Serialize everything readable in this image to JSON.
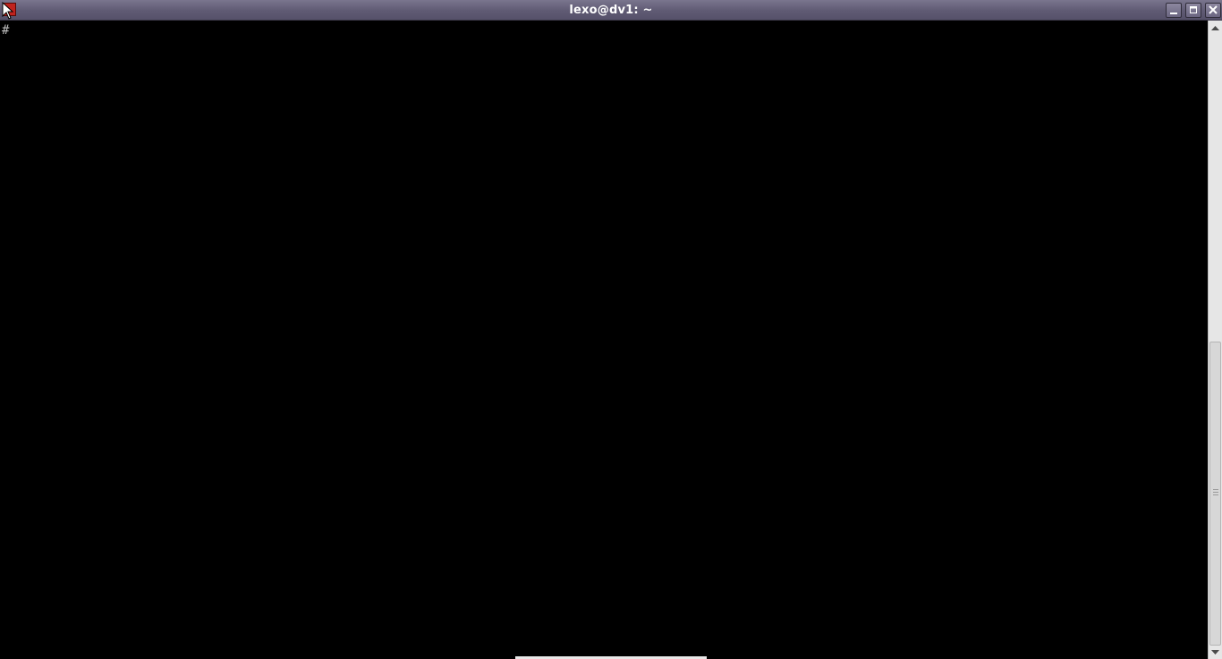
{
  "window": {
    "title": "lexo@dv1: ~",
    "titlebar_color": "#5f5a73",
    "app_icon": "terminal-app-icon"
  },
  "controls": {
    "minimize_icon": "minimize-icon",
    "maximize_icon": "maximize-icon",
    "close_icon": "close-icon"
  },
  "terminal": {
    "background": "#000000",
    "foreground": "#bdbdbd",
    "lines": [
      "#"
    ]
  },
  "scrollbar": {
    "up_icon": "scroll-up-arrow-icon",
    "down_icon": "scroll-down-arrow-icon"
  }
}
